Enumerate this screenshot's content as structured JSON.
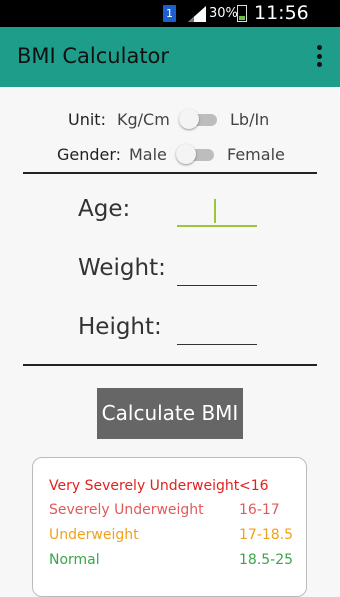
{
  "status_bar": {
    "sim_label": "1",
    "battery_percent": "30%",
    "time": "11:56 AM"
  },
  "app_bar": {
    "title": "BMI Calculator",
    "overflow_icon": "more-vert-icon"
  },
  "unit": {
    "label": "Unit:",
    "left_option": "Kg/Cm",
    "right_option": "Lb/In",
    "toggled": false
  },
  "gender": {
    "label": "Gender:",
    "left_option": "Male",
    "right_option": "Female",
    "toggled": false
  },
  "form": {
    "age_label": "Age:",
    "weight_label": "Weight:",
    "height_label": "Height:",
    "age_value": "",
    "weight_value": "",
    "height_value": ""
  },
  "calculate_button": "Calculate BMI",
  "bmi_table": [
    {
      "category": "Very Severely Underweight",
      "range": "<16",
      "color": "#e0211f"
    },
    {
      "category": "Severely Underweight",
      "range": "16-17",
      "color": "#e05a5a"
    },
    {
      "category": "Underweight",
      "range": "17-18.5",
      "color": "#f0a11a"
    },
    {
      "category": "Normal",
      "range": "18.5-25",
      "color": "#3aa64a"
    }
  ]
}
